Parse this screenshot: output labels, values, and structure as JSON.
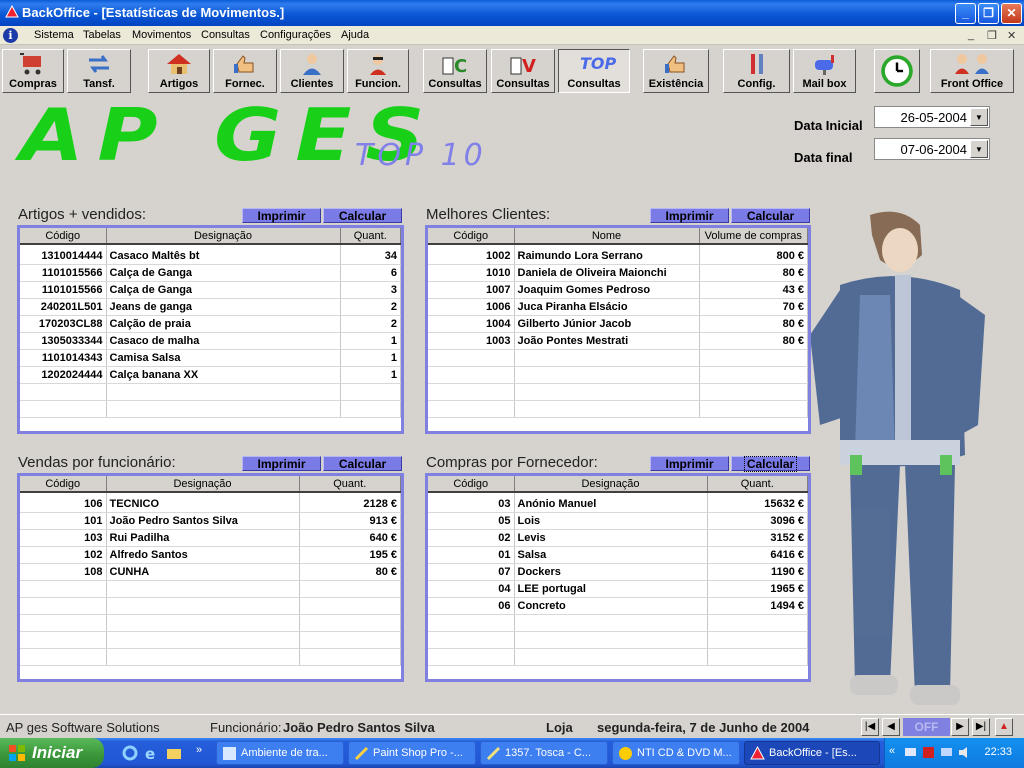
{
  "window": {
    "title": "BackOffice - [Estatísticas de Movimentos.]"
  },
  "menu": {
    "items": [
      "Sistema",
      "Tabelas",
      "Movimentos",
      "Consultas",
      "Configurações",
      "Ajuda"
    ]
  },
  "toolbar": {
    "buttons": [
      {
        "label": "Compras",
        "icon": "cart-icon"
      },
      {
        "label": "Tansf.",
        "icon": "transfer-icon"
      },
      {
        "label": "Artigos",
        "icon": "house-icon"
      },
      {
        "label": "Fornec.",
        "icon": "thumbs-up-icon"
      },
      {
        "label": "Clientes",
        "icon": "person-icon"
      },
      {
        "label": "Funcion.",
        "icon": "employee-icon"
      },
      {
        "label": "Consultas",
        "icon": "consultas-c-icon"
      },
      {
        "label": "Consultas",
        "icon": "consultas-v-icon"
      },
      {
        "label": "Consultas",
        "icon": "consultas-top-icon"
      },
      {
        "label": "Existência",
        "icon": "thumbs-up-icon"
      },
      {
        "label": "Config.",
        "icon": "tools-icon"
      },
      {
        "label": "Mail box",
        "icon": "mailbox-icon"
      },
      {
        "label": "",
        "icon": "clock-icon"
      },
      {
        "label": "Front Office",
        "icon": "people-icon"
      }
    ]
  },
  "logo": {
    "main": "AP GES",
    "sub": "TOP 10"
  },
  "dates": {
    "start_label": "Data Inicial",
    "start_value": "26-05-2004",
    "end_label": "Data final",
    "end_value": "07-06-2004"
  },
  "common": {
    "print": "Imprimir",
    "calc": "Calcular"
  },
  "panels": {
    "artigos": {
      "title": "Artigos + vendidos:",
      "headers": [
        "Código",
        "Designação",
        "Quant."
      ],
      "rows": [
        [
          "1310014444",
          "Casaco Maltês bt",
          "34"
        ],
        [
          "1101015566",
          "Calça de Ganga",
          "6"
        ],
        [
          "1101015566",
          "Calça de Ganga",
          "3"
        ],
        [
          "240201L501",
          "Jeans de ganga",
          "2"
        ],
        [
          "170203CL88",
          "Calção de praia",
          "2"
        ],
        [
          "1305033344",
          "Casaco de malha",
          "1"
        ],
        [
          "1101014343",
          "Camisa Salsa",
          "1"
        ],
        [
          "1202024444",
          "Calça banana XX",
          "1"
        ]
      ]
    },
    "clientes": {
      "title": "Melhores Clientes:",
      "headers": [
        "Código",
        "Nome",
        "Volume de compras"
      ],
      "rows": [
        [
          "1002",
          "Raimundo Lora Serrano",
          "800 €"
        ],
        [
          "1010",
          "Daniela de Oliveira Maionchi",
          "80 €"
        ],
        [
          "1007",
          "Joaquim Gomes Pedroso",
          "43 €"
        ],
        [
          "1006",
          "Juca Piranha Elsácio",
          "70 €"
        ],
        [
          "1004",
          "Gilberto Júnior Jacob",
          "80 €"
        ],
        [
          "1003",
          "João Pontes Mestrati",
          "80 €"
        ]
      ]
    },
    "vendas": {
      "title": "Vendas por funcionário:",
      "headers": [
        "Código",
        "Designação",
        "Quant."
      ],
      "rows": [
        [
          "106",
          "TECNICO",
          "2128 €"
        ],
        [
          "101",
          "João Pedro Santos Silva",
          "913 €"
        ],
        [
          "103",
          "Rui Padilha",
          "640 €"
        ],
        [
          "102",
          "Alfredo Santos",
          "195 €"
        ],
        [
          "108",
          "CUNHA",
          "80 €"
        ]
      ]
    },
    "compras": {
      "title": "Compras por Fornecedor:",
      "headers": [
        "Código",
        "Designação",
        "Quant."
      ],
      "rows": [
        [
          "03",
          "Anónio Manuel",
          "15632 €"
        ],
        [
          "05",
          "Lois",
          "3096 €"
        ],
        [
          "02",
          "Levis",
          "3152 €"
        ],
        [
          "01",
          "Salsa",
          "6416 €"
        ],
        [
          "07",
          "Dockers",
          "1190 €"
        ],
        [
          "04",
          "LEE portugal",
          "1965 €"
        ],
        [
          "06",
          "Concreto",
          "1494 €"
        ]
      ]
    }
  },
  "statusbar": {
    "company": "AP ges Software Solutions",
    "employee_label": "Funcionário:",
    "employee_name": "João Pedro Santos Silva",
    "store": "Loja",
    "date": "segunda-feira, 7 de Junho de 2004",
    "nav_state": "OFF"
  },
  "taskbar": {
    "start": "Iniciar",
    "tasks": [
      "Ambiente de tra...",
      "Paint Shop Pro -...",
      "1357. Tosca - C...",
      "NTI CD & DVD M...",
      "BackOffice - [Es..."
    ],
    "clock": "22:33"
  },
  "colors": {
    "accent": "#7b7be8",
    "logo_green": "#18d018",
    "title_blue": "#0a5bd6"
  }
}
